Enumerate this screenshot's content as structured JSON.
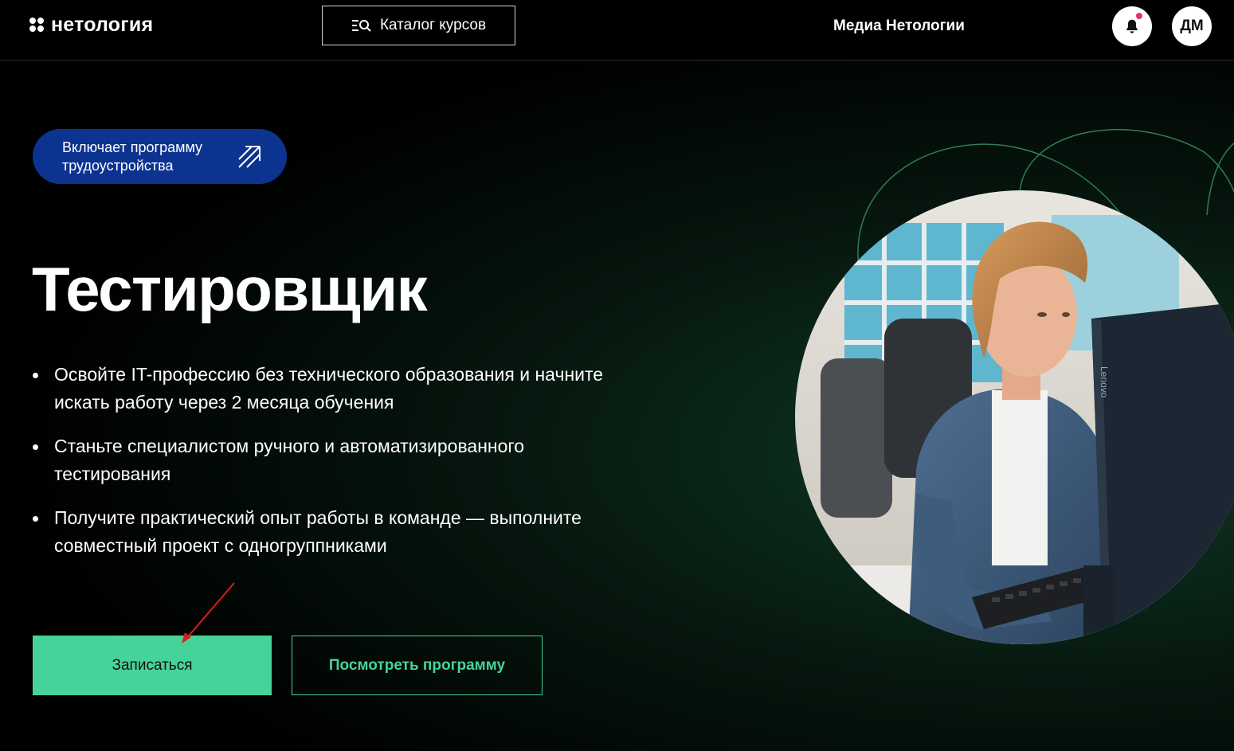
{
  "header": {
    "logo_text": "нетология",
    "catalog_label": "Каталог курсов",
    "media_link": "Медиа Нетологии",
    "avatar_initials": "ДМ",
    "has_unread_notification": true
  },
  "hero": {
    "badge_text": "Включает программу\nтрудоустройства",
    "title": "Тестировщик",
    "benefits": [
      "Освойте IT-профессию без технического образования и начните искать работу через 2 месяца обучения",
      "Станьте специалистом ручного и автоматизированного тестирования",
      "Получите практический опыт работы в команде — выполните совместный проект с одногруппниками"
    ],
    "signup_label": "Записаться",
    "program_label": "Посмотреть программу",
    "monitor_brand": "Lenovo"
  },
  "colors": {
    "accent_green": "#46d39a",
    "badge_blue": "#0d3390",
    "notification_dot": "#e8335f"
  },
  "icons": {
    "logo": "netology-logo-icon",
    "catalog": "menu-search-icon",
    "notifications": "bell-icon",
    "badge": "arrow-up-right-icon"
  }
}
